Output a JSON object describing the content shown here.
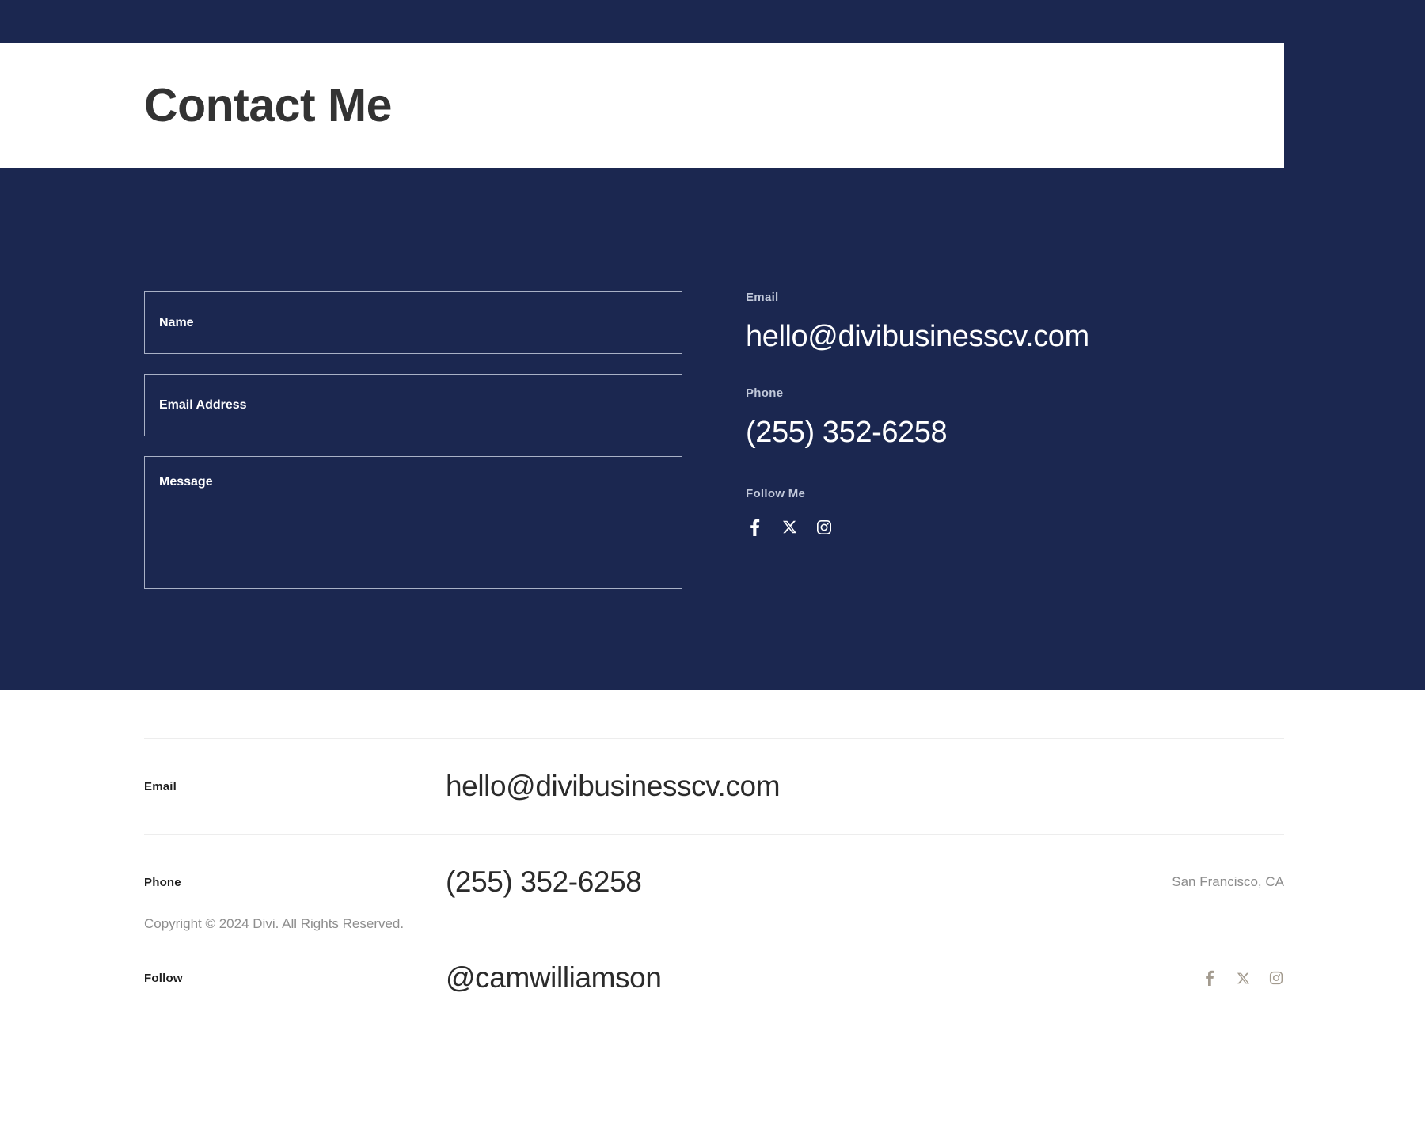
{
  "colors": {
    "navy": "#1b2750",
    "banner_bg": "#ffffff",
    "title_text": "#333333",
    "label_light": "#c2c9da",
    "value_white": "#ffffff",
    "field_border": "#a9b1c6",
    "footer_divider": "#ededed",
    "footer_label": "#1f1f1f",
    "footer_value": "#2b2b2b",
    "muted_gray": "#8c8c8c",
    "footer_icon": "#a39b8f"
  },
  "header": {
    "title": "Contact Me"
  },
  "form": {
    "fields": [
      {
        "name": "name",
        "placeholder": "Name",
        "value": ""
      },
      {
        "name": "email",
        "placeholder": "Email Address",
        "value": ""
      },
      {
        "name": "message",
        "placeholder": "Message",
        "value": ""
      }
    ]
  },
  "contact": {
    "email_label": "Email",
    "email_value": "hello@divibusinesscv.com",
    "phone_label": "Phone",
    "phone_value": "(255) 352-6258",
    "follow_label": "Follow Me",
    "socials": [
      {
        "icon": "facebook-icon",
        "name": "Facebook"
      },
      {
        "icon": "x-twitter-icon",
        "name": "X"
      },
      {
        "icon": "instagram-icon",
        "name": "Instagram"
      }
    ]
  },
  "footer": {
    "rows": [
      {
        "label": "Email",
        "value": "hello@divibusinesscv.com",
        "right": ""
      },
      {
        "label": "Phone",
        "value": "(255) 352-6258",
        "right": "San Francisco, CA"
      },
      {
        "label": "Follow",
        "value": "@camwilliamson",
        "right": ""
      }
    ],
    "socials": [
      {
        "icon": "facebook-icon",
        "name": "Facebook"
      },
      {
        "icon": "x-twitter-icon",
        "name": "X"
      },
      {
        "icon": "instagram-icon",
        "name": "Instagram"
      }
    ],
    "copyright": "Copyright © 2024 Divi. All Rights Reserved."
  }
}
